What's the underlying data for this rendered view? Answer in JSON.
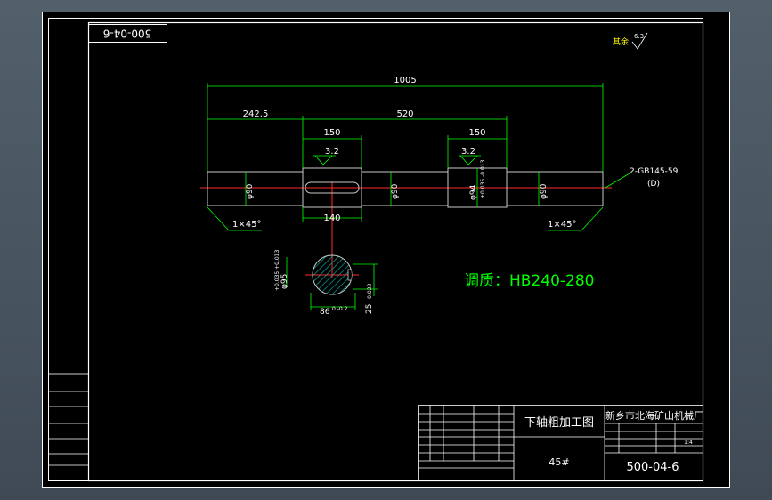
{
  "drawing": {
    "number_top": "500-04-6",
    "roughness_rest": "其余",
    "roughness_rest_value": "6.3",
    "dims": {
      "overall": "1005",
      "left": "242.5",
      "mid": "520",
      "seg1": "150",
      "seg2": "150",
      "keyway": "140",
      "chamfer_left": "1×45°",
      "chamfer_right": "1×45°",
      "dia1": "φ90",
      "dia2": "φ90",
      "dia3": "φ94",
      "dia3_tol": "+0.035 -0.013",
      "dia4": "φ90",
      "rough1": "3.2",
      "rough2": "3.2",
      "center_hole": "2-GB145-59",
      "center_hole_sub": "(D)"
    },
    "section": {
      "dia": "φ95",
      "dia_tol": "+0.035 +0.013",
      "width": "86",
      "width_tol": "0 -0.2",
      "key": "25",
      "key_tol": "-0.022"
    },
    "note": "调质：HB240-280",
    "title_block": {
      "part_name": "下轴粗加工图",
      "company": "新乡市北海矿山机械厂",
      "material": "45#",
      "drawing_no": "500-04-6",
      "scale": "1:4"
    }
  }
}
